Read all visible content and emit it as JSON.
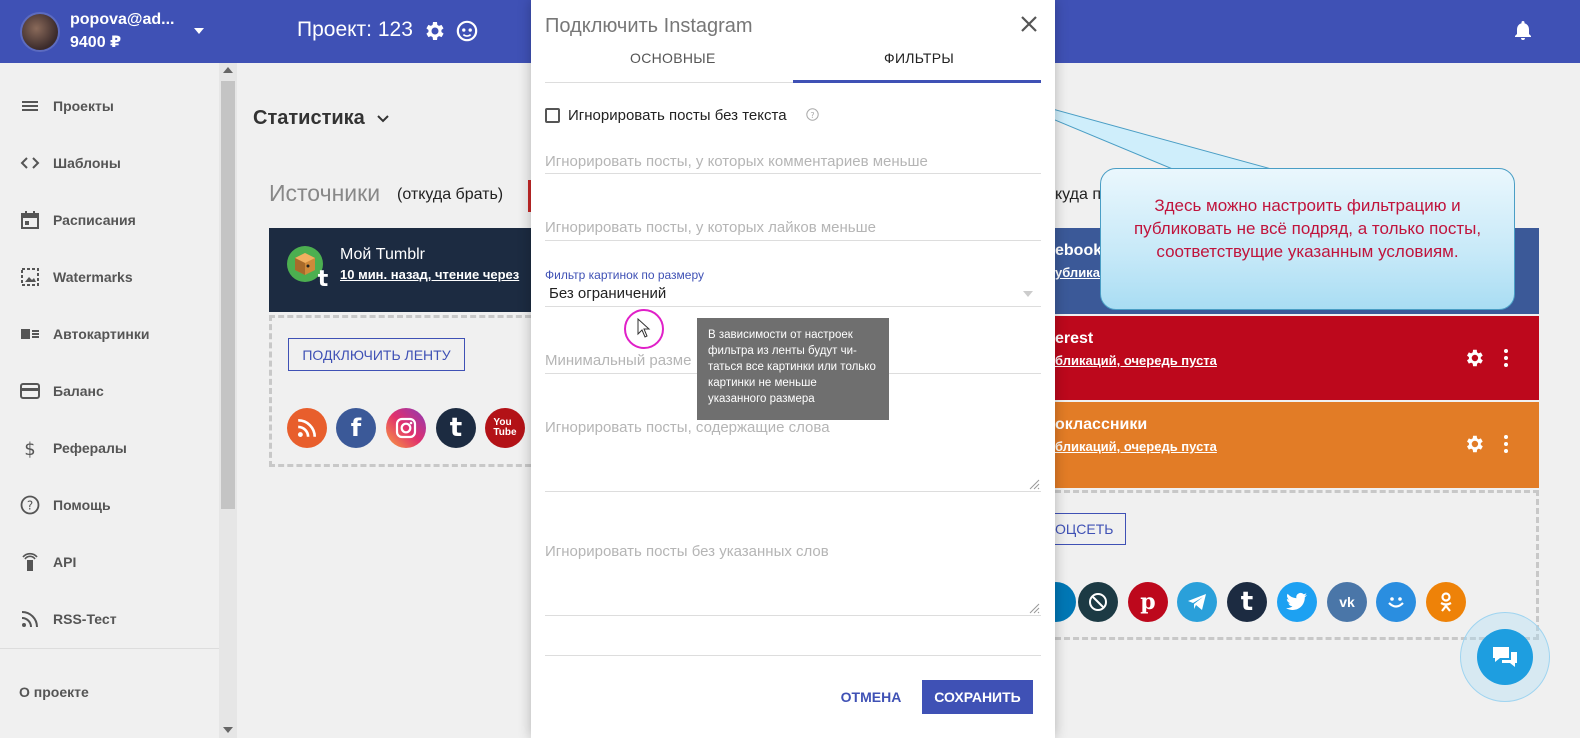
{
  "header": {
    "user_email": "popova@ad...",
    "user_balance": "9400 ₽",
    "project_label": "Проект: 123"
  },
  "sidebar": {
    "items": [
      {
        "label": "Проекты",
        "icon": "list-icon"
      },
      {
        "label": "Шаблоны",
        "icon": "code-icon"
      },
      {
        "label": "Расписания",
        "icon": "calendar-icon"
      },
      {
        "label": "Watermarks",
        "icon": "image-icon"
      },
      {
        "label": "Автокартинки",
        "icon": "autoimage-icon"
      },
      {
        "label": "Баланс",
        "icon": "card-icon"
      },
      {
        "label": "Рефералы",
        "icon": "dollar-icon"
      },
      {
        "label": "Помощь",
        "icon": "help-icon"
      },
      {
        "label": "API",
        "icon": "api-icon"
      },
      {
        "label": "RSS-Тест",
        "icon": "rss-icon"
      }
    ],
    "about": "О проекте"
  },
  "main": {
    "stats_title": "Статистика",
    "sources_title": "Источники",
    "sources_sub": "(откуда брать)",
    "dest_header_fragment": "куда п",
    "source_card": {
      "name": "Мой Tumblr",
      "status": "10 мин. назад, чтение через"
    },
    "connect_feed": "ПОДКЛЮЧИТЬ ЛЕНТУ",
    "connect_social_fragment": "ОЦСЕТЬ",
    "destinations": [
      {
        "name": "ebook",
        "status": "убликаций",
        "color": "#3b5998"
      },
      {
        "name": "erest",
        "status": "бликаций, очередь пуста",
        "color": "#bd081c"
      },
      {
        "name": "оклассники",
        "status": "бликаций, очередь пуста",
        "color": "#e27c26"
      }
    ]
  },
  "modal": {
    "title": "Подключить Instagram",
    "tabs": [
      "ОСНОВНЫЕ",
      "ФИЛЬТРЫ"
    ],
    "active_tab": "ФИЛЬТРЫ",
    "checkbox_label": "Игнорировать посты без текста",
    "fields": {
      "min_comments": "Игнорировать посты, у которых комментариев меньше",
      "min_likes": "Игнорировать посты, у которых лайков меньше",
      "image_filter_caption": "Фильтр картинок по размеру",
      "image_filter_value": "Без ограничений",
      "min_size": "Минимальный разме",
      "ignore_words": "Игнорировать посты, содержащие слова",
      "require_words": "Игнорировать посты без указанных слов"
    },
    "tooltip": "В зависимости от настроек фильтра из ленты будут чи-таться все картинки или только картинки не меньше указанного размера",
    "cancel": "ОТМЕНА",
    "save": "СОХРАНИТЬ"
  },
  "callout": {
    "text": "Здесь можно настроить фильтрацию и публиковать не всё подряд, а только посты, соответствущие указанным условиям."
  },
  "colors": {
    "primary": "#3f51b5",
    "callout_text": "#c0143c",
    "chat": "#1e9ee0"
  }
}
